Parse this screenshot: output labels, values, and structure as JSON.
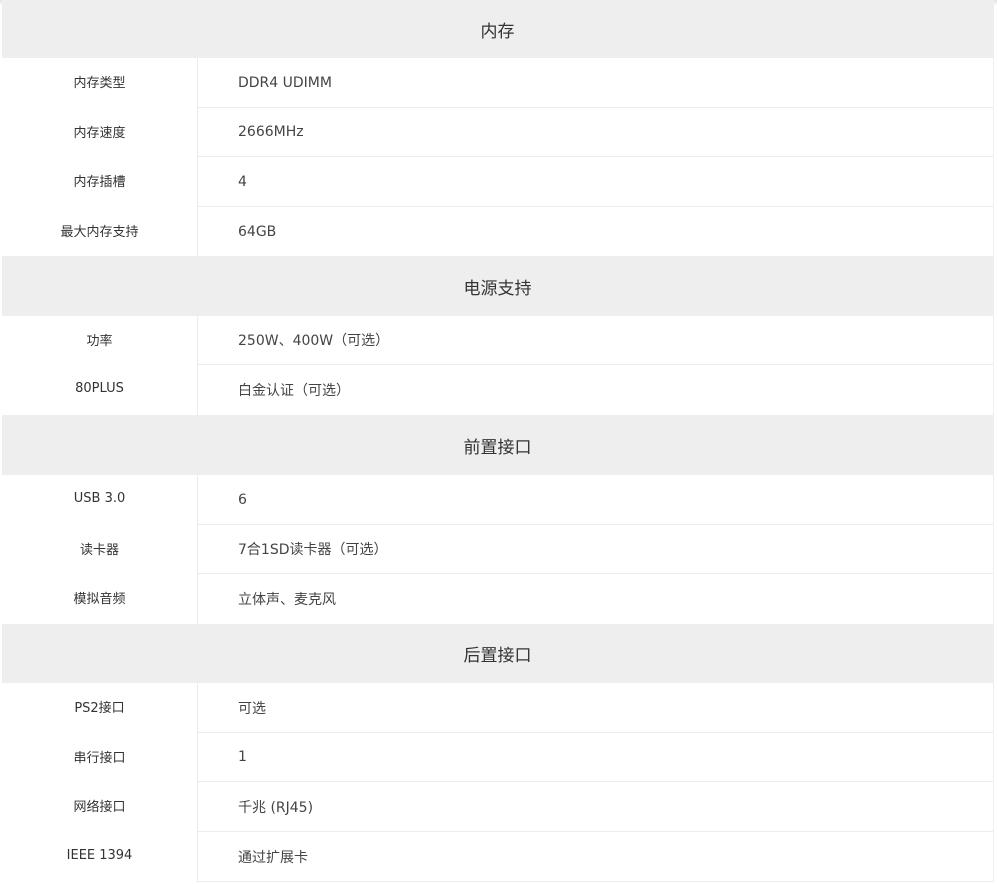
{
  "sections": [
    {
      "title": "内存",
      "rows": [
        {
          "label": "内存类型",
          "value": "DDR4 UDIMM"
        },
        {
          "label": "内存速度",
          "value": "2666MHz"
        },
        {
          "label": "内存插槽",
          "value": "4"
        },
        {
          "label": "最大内存支持",
          "value": "64GB"
        }
      ]
    },
    {
      "title": "电源支持",
      "rows": [
        {
          "label": "功率",
          "value": "250W、400W（可选）"
        },
        {
          "label": "80PLUS",
          "value": "白金认证（可选）"
        }
      ]
    },
    {
      "title": "前置接口",
      "rows": [
        {
          "label": "USB 3.0",
          "value": "6"
        },
        {
          "label": "读卡器",
          "value": "7合1SD读卡器（可选）"
        },
        {
          "label": "模拟音频",
          "value": "立体声、麦克风"
        }
      ]
    },
    {
      "title": "后置接口",
      "rows": [
        {
          "label": "PS2接口",
          "value": "可选"
        },
        {
          "label": "串行接口",
          "value": "1"
        },
        {
          "label": "网络接口",
          "value": "千兆 (RJ45)"
        },
        {
          "label": "IEEE 1394",
          "value": "通过扩展卡"
        }
      ]
    }
  ]
}
